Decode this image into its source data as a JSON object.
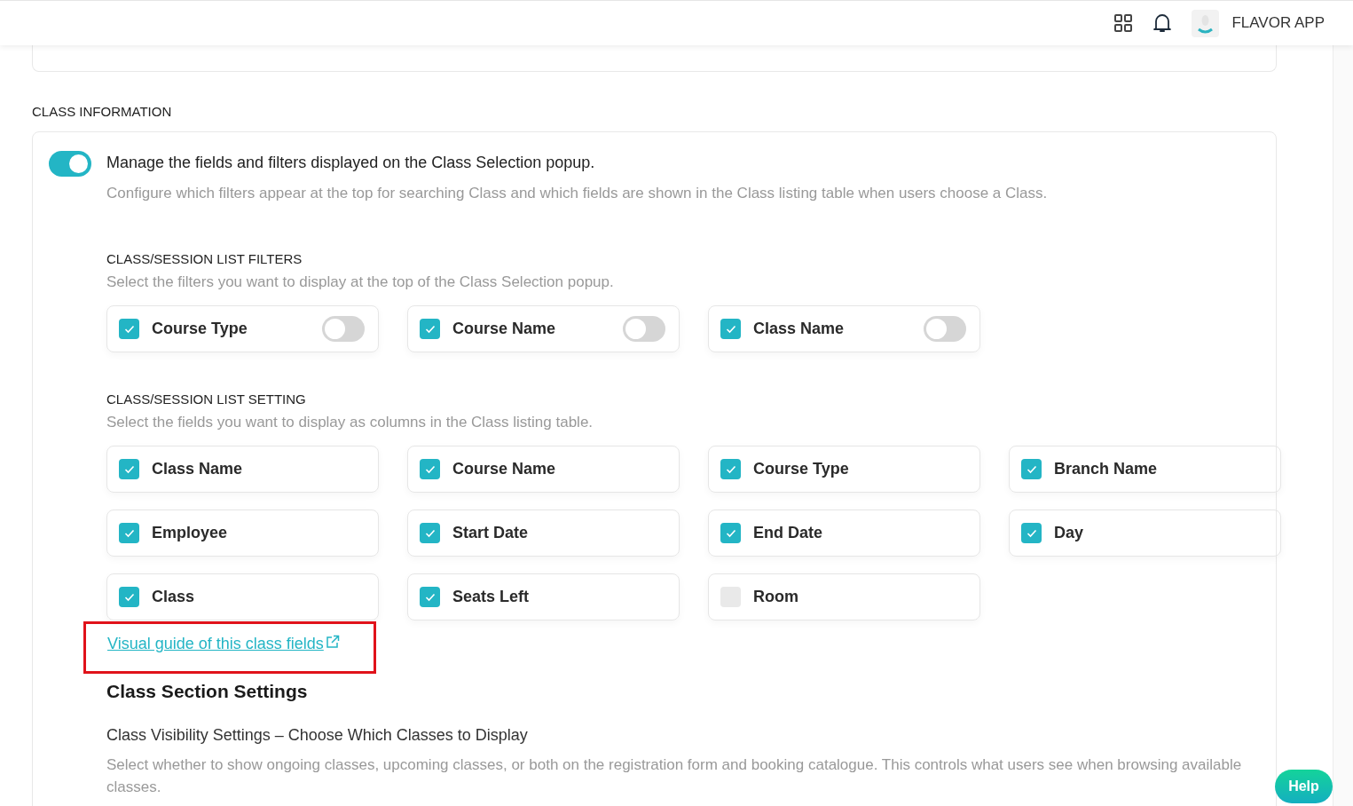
{
  "header": {
    "app_name": "FLAVOR APP"
  },
  "section_title": "CLASS INFORMATION",
  "manage": {
    "on": true,
    "title": "Manage the fields and filters displayed on the Class Selection popup.",
    "description": "Configure which filters appear at the top for searching Class and which fields are shown in the Class listing table when users choose a Class."
  },
  "filters": {
    "title": "CLASS/SESSION LIST FILTERS",
    "description": "Select the filters you want to display at the top of the Class Selection popup.",
    "items": [
      {
        "label": "Course Type",
        "checked": true,
        "on": false
      },
      {
        "label": "Course Name",
        "checked": true,
        "on": false
      },
      {
        "label": "Class Name",
        "checked": true,
        "on": false
      }
    ]
  },
  "settings": {
    "title": "CLASS/SESSION LIST SETTING",
    "description": "Select the fields you want to display as columns in the Class listing table.",
    "items": [
      {
        "label": "Class Name",
        "checked": true
      },
      {
        "label": "Course Name",
        "checked": true
      },
      {
        "label": "Course Type",
        "checked": true
      },
      {
        "label": "Branch Name",
        "checked": true
      },
      {
        "label": "Employee",
        "checked": true
      },
      {
        "label": "Start Date",
        "checked": true
      },
      {
        "label": "End Date",
        "checked": true
      },
      {
        "label": "Day",
        "checked": true
      },
      {
        "label": "Class",
        "checked": true
      },
      {
        "label": "Seats Left",
        "checked": true
      },
      {
        "label": "Room",
        "checked": false
      }
    ]
  },
  "guide_link": "Visual guide of this class fields",
  "class_section": {
    "title": "Class Section Settings",
    "subtitle": "Class Visibility Settings – Choose Which Classes to Display",
    "description": "Select whether to show ongoing classes, upcoming classes, or both on the registration form and booking catalogue. This controls what users see when browsing available classes."
  },
  "help_button": "Help"
}
